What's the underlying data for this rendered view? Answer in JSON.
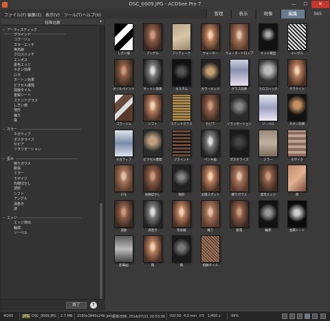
{
  "window": {
    "title": "DSC_0009.JPG - ACDSee Pro 7",
    "minimize": "—",
    "maximize": "☐",
    "close": "✕"
  },
  "menu": [
    "ファイル(F)",
    "編集(E)",
    "表示(V)",
    "ツール(T)",
    "ヘルプ(H)"
  ],
  "modes": [
    {
      "label": "管理",
      "active": false
    },
    {
      "label": "表示",
      "active": false
    },
    {
      "label": "現像",
      "active": false
    },
    {
      "label": "編集",
      "active": true
    },
    {
      "label": "365",
      "active": false
    }
  ],
  "panel": {
    "title": "特殊効果",
    "done_label": "終了",
    "help_label": "?",
    "categories": [
      {
        "label": "アーティスティック",
        "toggle": "−",
        "items": [
          "ブラインド",
          "コラージュ",
          "カラーエッチ",
          "等高線",
          "クロスハッチ",
          "エンボス",
          "柔毛エッジ",
          "ネオン効果",
          "ロモ",
          "オートン効果",
          "ピクセル爆発",
          "飛散タイル",
          "金属シート",
          "ステンドグラス",
          "しきい値",
          "地形",
          "織り",
          "風"
        ]
      },
      {
        "label": "カラー",
        "toggle": "−",
        "items": [
          "ネガティブ",
          "ポスタライズ",
          "セピア",
          "ソラリゼーション"
        ]
      },
      {
        "label": "歪み",
        "toggle": "−",
        "items": [
          "擦りガラス",
          "膨張",
          "ミラー",
          "モザイク",
          "光線ぼかし",
          "波紋",
          "シフト",
          "アングル",
          "渦巻き",
          "波"
        ]
      },
      {
        "label": "エッジ",
        "toggle": "−",
        "items": [
          "エッジ検出",
          "輪郭",
          "ソーベル"
        ]
      }
    ]
  },
  "grid": {
    "rows": [
      [
        "しきい値",
        "アングル",
        "アンティーク",
        "ウォーター",
        "ウォータードロップ",
        "エッジ検出",
        "エンボス"
      ],
      [
        "オイルペイント",
        "オートン効果",
        "カスタム",
        "カラーエッジ",
        "グラス効果",
        "クロスハッチ",
        "グラナイト"
      ],
      [
        "コラージュ",
        "シフト",
        "ステンドグラス",
        "セピア",
        "ソラリゼーション",
        "ソーベル",
        "ネオン効果"
      ],
      [
        "ネガティブ",
        "ピクセル爆発",
        "ブラインド",
        "ペンキ画",
        "ポスタライズ",
        "ミラー",
        "モザイク"
      ],
      [
        "ロモ",
        "光線ぼかし",
        "地形",
        "太陽スポット",
        "擦りガラス",
        "柔毛エッジ",
        "渦"
      ],
      [
        "波紋",
        "渦巻き",
        "等高線",
        "織り",
        "膨張",
        "輪郭",
        "金属シート"
      ],
      [
        "鉛筆画",
        "雨",
        "風",
        "飛散タイル"
      ]
    ]
  },
  "status": {
    "index": "40/65",
    "format": "JPG",
    "filename": "DSC_0009.JPG",
    "filesize": "2.7 MB",
    "dimensions": "2160x3840x24b jpeg",
    "modified": "更新日時: 2014/07/21 20:53:36",
    "iso": "ISO 50",
    "focal": "4.9 mm",
    "aperture": "f/3",
    "shutter": "1/400 s",
    "zoom": "99%"
  },
  "colors": {
    "accent_active_tab": "#6a7b8e",
    "close_button": "#c9352b",
    "app_icon": "#d9622b"
  }
}
